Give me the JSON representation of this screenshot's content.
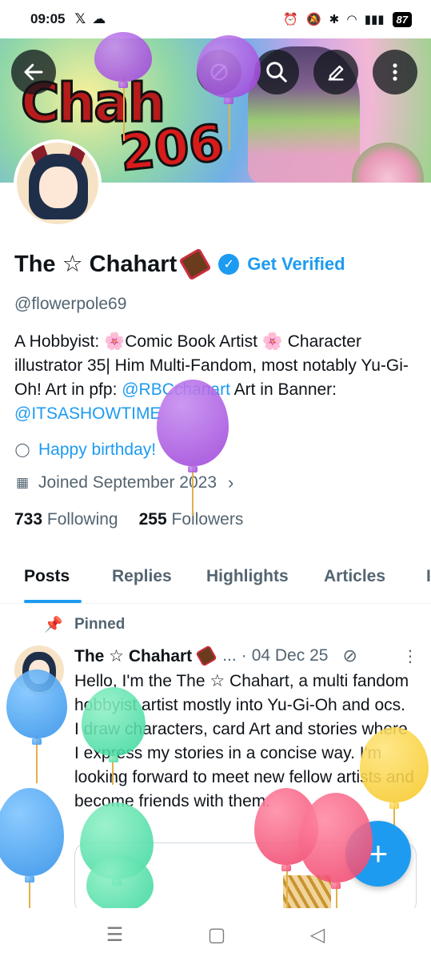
{
  "status_bar": {
    "time": "09:05",
    "left_icons": [
      "x-logo-icon",
      "cloud-icon"
    ],
    "right_icons": [
      "alarm-icon",
      "mute-icon",
      "bluetooth-icon",
      "wifi-icon",
      "signal-icon"
    ],
    "battery": "87"
  },
  "header": {
    "back_icon": "arrow-left-icon",
    "grok_icon": "grok-icon",
    "search_icon": "search-icon",
    "edit_icon": "edit-icon",
    "more_icon": "more-vertical-icon",
    "banner_text_1": "Chah",
    "banner_text_2": "206"
  },
  "profile": {
    "name": "The ☆ Chahart",
    "verify_label": "Get Verified",
    "handle": "@flowerpole69",
    "bio_part1": "A Hobbyist: 🌸Comic Book Artist  🌸 Character illustrator  35| Him Multi-Fandom, most notably Yu-Gi-Oh!  Art in pfp: ",
    "bio_link1": "@RBCchanart",
    "bio_part2": " Art  in Banner: ",
    "bio_link2": "@ITSASHOWTIME",
    "birthday": "Happy birthday!",
    "joined": "Joined September 2023",
    "following_count": "733",
    "following_label": "Following",
    "followers_count": "255",
    "followers_label": "Followers"
  },
  "tabs": {
    "posts": "Posts",
    "replies": "Replies",
    "highlights": "Highlights",
    "articles": "Articles",
    "partial": "I",
    "active": "Posts"
  },
  "pinned_post": {
    "pinned_label": "Pinned",
    "author": "The ☆ Chahart",
    "ellipsis": "...",
    "dot": "·",
    "date": "04 Dec 25",
    "text": "Hello, I'm the The ☆ Chahart, a multi fandom hobbyist artist mostly into Yu-Gi-Oh and ocs. I draw characters, card Art and stories where I express my stories in a concise way. I'm looking forward to meet new fellow artists and become friends with them."
  },
  "fab": {
    "icon": "plus-icon"
  },
  "nav": [
    "recent-apps-icon",
    "home-icon",
    "back-icon"
  ],
  "colors": {
    "accent": "#1d9bf0",
    "balloon_purple": "#9b3fd8",
    "balloon_blue": "#2b8de8",
    "balloon_green": "#34d69a",
    "balloon_yellow": "#f6c51d",
    "balloon_red": "#ef3f68"
  }
}
